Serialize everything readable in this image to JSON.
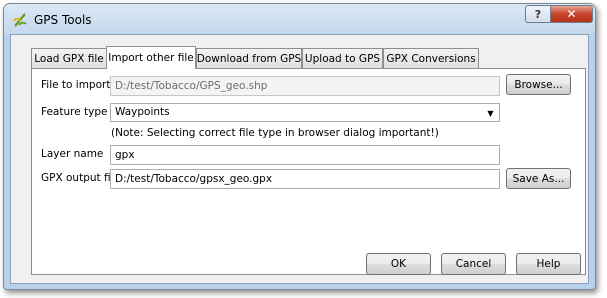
{
  "window": {
    "title": "GPS Tools",
    "help_label": "?",
    "close_label": "✕"
  },
  "tabs": [
    {
      "label": "Load GPX file"
    },
    {
      "label": "Import other file"
    },
    {
      "label": "Download from GPS"
    },
    {
      "label": "Upload to GPS"
    },
    {
      "label": "GPX Conversions"
    }
  ],
  "active_tab": "Import other file",
  "form": {
    "file_label": "File to import",
    "file_value": "D:/test/Tobacco/GPS_geo.shp",
    "browse_label": "Browse...",
    "feature_label": "Feature type",
    "feature_value": "Waypoints",
    "note": "(Note: Selecting correct file type in browser dialog important!)",
    "layer_label": "Layer name",
    "layer_value": "gpx",
    "output_label": "GPX output file",
    "output_value": "D:/test/Tobacco/gpsx_geo.gpx",
    "save_as_label": "Save As..."
  },
  "footer": {
    "ok_label": "OK",
    "cancel_label": "Cancel",
    "help_label": "Help"
  },
  "icons": {
    "app": "qgis-icon",
    "dropdown": "chevron-down-icon"
  }
}
